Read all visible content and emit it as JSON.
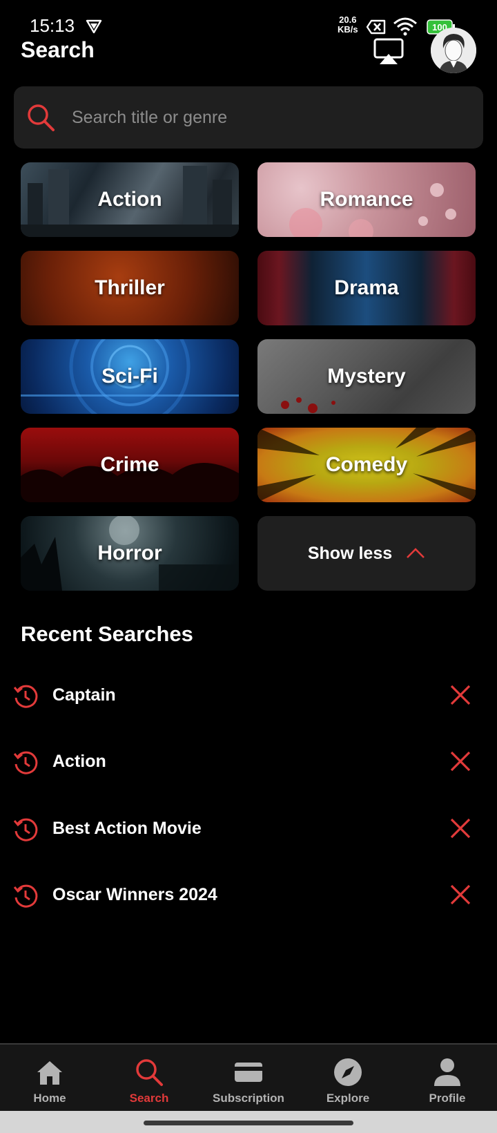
{
  "status_bar": {
    "time": "15:13",
    "net_speed_value": "20.6",
    "net_speed_unit": "KB/s",
    "battery": "100"
  },
  "header": {
    "title": "Search"
  },
  "search": {
    "placeholder": "Search title or genre",
    "value": ""
  },
  "genres": [
    {
      "label": "Action"
    },
    {
      "label": "Romance"
    },
    {
      "label": "Thriller"
    },
    {
      "label": "Drama"
    },
    {
      "label": "Sci-Fi"
    },
    {
      "label": "Mystery"
    },
    {
      "label": "Crime"
    },
    {
      "label": "Comedy"
    },
    {
      "label": "Horror"
    }
  ],
  "show_less_label": "Show less",
  "recent": {
    "title": "Recent Searches",
    "items": [
      {
        "label": "Captain"
      },
      {
        "label": "Action"
      },
      {
        "label": "Best Action Movie"
      },
      {
        "label": "Oscar Winners 2024"
      }
    ]
  },
  "nav": {
    "items": [
      {
        "label": "Home",
        "icon": "home-icon"
      },
      {
        "label": "Search",
        "icon": "search-icon"
      },
      {
        "label": "Subscription",
        "icon": "card-icon"
      },
      {
        "label": "Explore",
        "icon": "compass-icon"
      },
      {
        "label": "Profile",
        "icon": "person-icon"
      }
    ],
    "active": "Search"
  },
  "colors": {
    "accent": "#e23a3a",
    "background": "#000000",
    "surface": "#1f1f1f",
    "inactive": "#b3b3b3"
  }
}
